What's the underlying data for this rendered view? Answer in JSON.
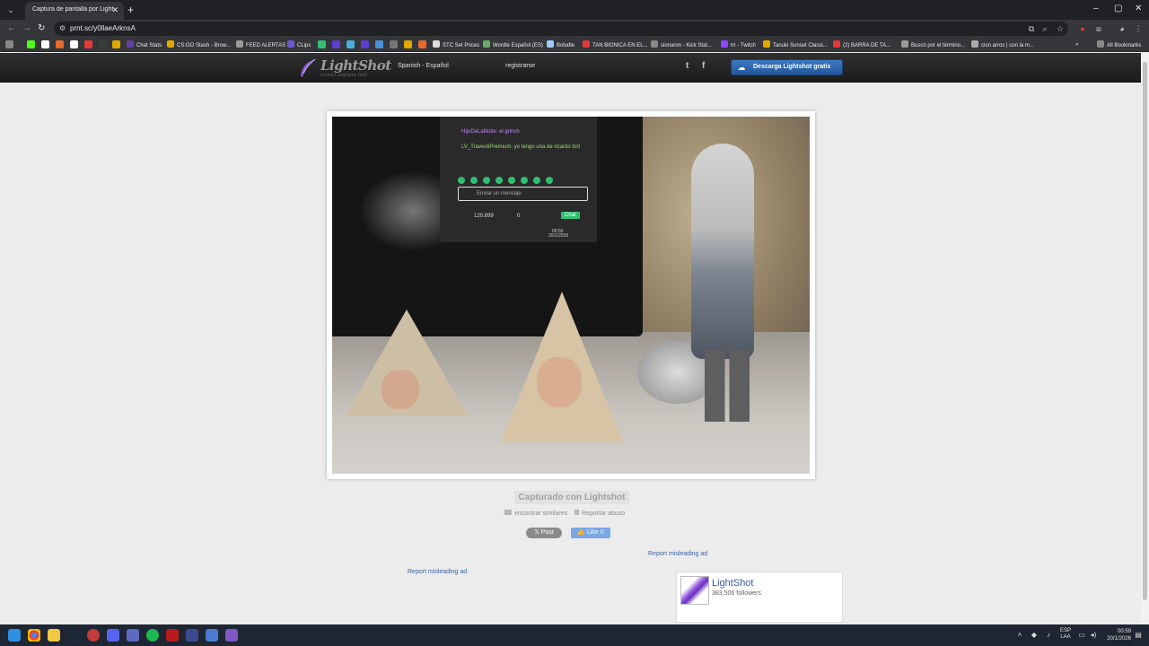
{
  "browser": {
    "tab_title": "Captura de pantalla por Lightsh",
    "tab_close": "✕",
    "new_tab": "+",
    "url": "prnt.sc/y0llaeArknsA",
    "win_minimize": "–",
    "win_maximize": "▢",
    "win_close": "✕",
    "bookmarks": [
      "Chat Stats",
      "CS:GO Stash - Brow...",
      "FEED ALERTAS",
      "CLips",
      "STC Set Prices",
      "Wordle Español (ES)",
      "Boludle",
      "TAN BIONICA EN EL...",
      "sionaron - Kick Stat...",
      "trr - Twitch",
      "Tanuki Sunset Classi...",
      "(2) BARRA DE TA...",
      "Buscó por el término...",
      "cion arros | con la m..."
    ],
    "all_bookmarks": "All Bookmarks"
  },
  "lightshot": {
    "logo": "LightShot",
    "logo_sub": "screen capture tool",
    "language": "Spanish - Español",
    "register": "registrarse",
    "twitter": "t",
    "facebook": "f",
    "download": "Descarga Lightshot gratis",
    "caption": "Capturado con Lightshot",
    "find_similar": "encontrar similares",
    "report_abuse": "Reportar abuso",
    "post": "𝕏 Post",
    "like": "👍 Like 0",
    "report_ad_right": "Report misleading ad",
    "report_ad_left": "Report misleading ad",
    "fb_name": "LightShot",
    "fb_followers": "383,506 followers"
  },
  "screenshot_content": {
    "chat_user1": "HijoDeLaNoite: el grinch",
    "chat_user2": "LV_TravestiPremium: yo tengo una de ricardo fort",
    "chat_input": "Enviar un mensaje",
    "points": "120.899",
    "count": "0",
    "chat_button": "Chat",
    "screen_time": "00:56",
    "screen_date": "20/1/2026"
  },
  "taskbar": {
    "lang_line1": "ESP",
    "lang_line2": "LAA",
    "time": "00:59",
    "date": "20/1/2026"
  },
  "colors": {
    "accent": "#3b78c2",
    "header_bg": "#222222",
    "page_bg": "#ececec"
  }
}
